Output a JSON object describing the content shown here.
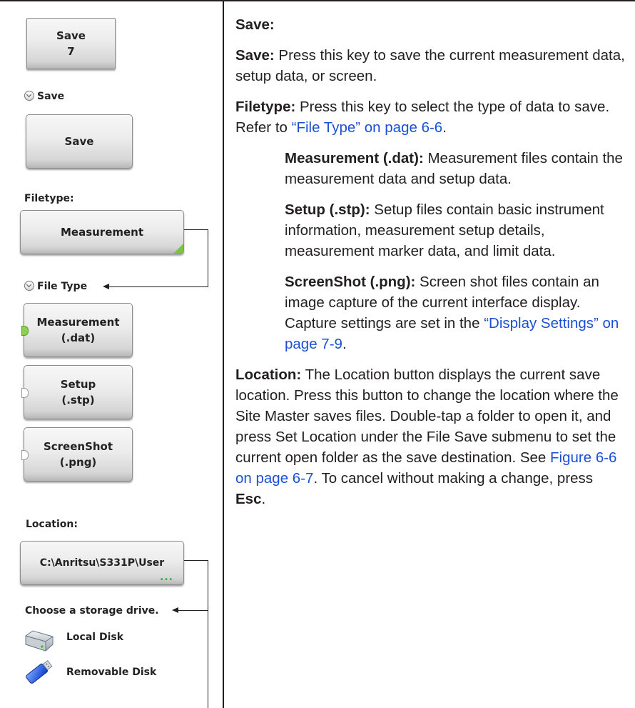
{
  "left_panel": {
    "save7_button": {
      "line1": "Save",
      "line2": "7"
    },
    "save_menu_label": "Save",
    "save_button": "Save",
    "filetype_label": "Filetype:",
    "filetype_button": "Measurement",
    "filetype_menu_label": "File Type",
    "filetype_options": [
      {
        "line1": "Measurement",
        "line2": "(.dat)",
        "selected": true
      },
      {
        "line1": "Setup",
        "line2": "(.stp)",
        "selected": false
      },
      {
        "line1": "ScreenShot",
        "line2": "(.png)",
        "selected": false
      }
    ],
    "location_label": "Location:",
    "location_button": "C:\\Anritsu\\S331P\\User",
    "location_dots": "...",
    "choose_drive_label": "Choose a storage drive.",
    "drives": [
      "Local Disk",
      "Removable Disk"
    ],
    "colors": {
      "selected_indicator": "#8ed14f",
      "dots": "#3aaa35"
    }
  },
  "right_panel": {
    "heading": "Save:",
    "save": {
      "term": "Save:",
      "text": " Press this key to save the current measurement data, setup data, or screen."
    },
    "filetype": {
      "term": "Filetype:",
      "text": " Press this key to select the type of data to save. Refer to ",
      "link": "“File Type” on page 6-6",
      "tail": "."
    },
    "measurement": {
      "term": "Measurement (.dat):",
      "text": " Measurement files contain the measurement data and setup data."
    },
    "setup": {
      "term": "Setup (.stp):",
      "text": " Setup files contain basic instrument information, measurement setup details, measurement marker data, and limit data."
    },
    "screenshot": {
      "term": "ScreenShot (.png):",
      "text": " Screen shot files contain an image capture of the current interface display. Capture settings are set in the ",
      "link": "“Display Settings” on page 7-9",
      "tail": "."
    },
    "location": {
      "term": "Location:",
      "text": " The Location button displays the current save location. Press this button to change the location where the Site Master saves files. Double-tap a folder to open it, and press Set Location under the File Save submenu to set the current open folder as the save destination. See ",
      "link": "Figure 6-6 on page 6-7",
      "text2": ". To cancel without making a change, press ",
      "esc": "Esc",
      "tail": "."
    },
    "link_color": "#1a4fd6"
  }
}
